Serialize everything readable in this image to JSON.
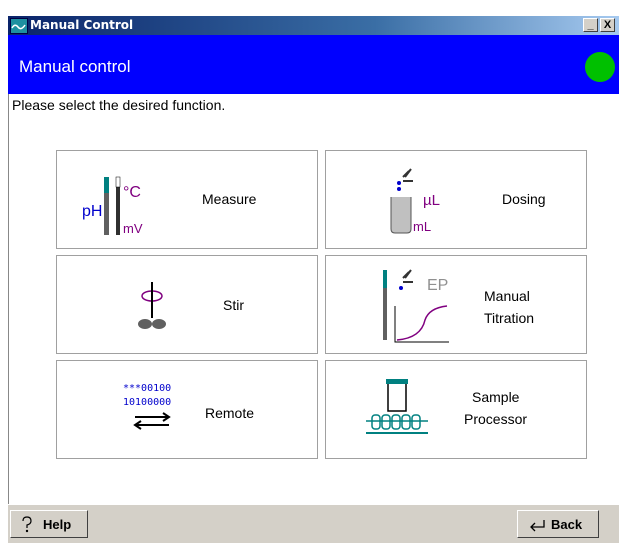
{
  "window": {
    "title": "Manual Control",
    "minimize_label": "_",
    "close_label": "X"
  },
  "header": {
    "title": "Manual control",
    "status_color": "#00c000"
  },
  "content": {
    "prompt": "Please select the desired function."
  },
  "tiles": {
    "measure": {
      "label": "Measure",
      "icon_ph": "pH",
      "icon_deg": "°C",
      "icon_mv": "mV"
    },
    "dosing": {
      "label": "Dosing",
      "icon_ul": "µL",
      "icon_ml": "mL"
    },
    "stir": {
      "label": "Stir"
    },
    "titration": {
      "label_line1": "Manual",
      "label_line2": "Titration",
      "icon_ep": "EP"
    },
    "remote": {
      "label": "Remote",
      "icon_line1": "***00100",
      "icon_line2": "10100000"
    },
    "sample": {
      "label_line1": "Sample",
      "label_line2": "Processor"
    }
  },
  "footer": {
    "help_label": "Help",
    "back_label": "Back"
  },
  "colors": {
    "header_bg": "#0000ff",
    "icon_blue": "#0000cc",
    "icon_purple": "#800080",
    "icon_teal": "#008080"
  }
}
